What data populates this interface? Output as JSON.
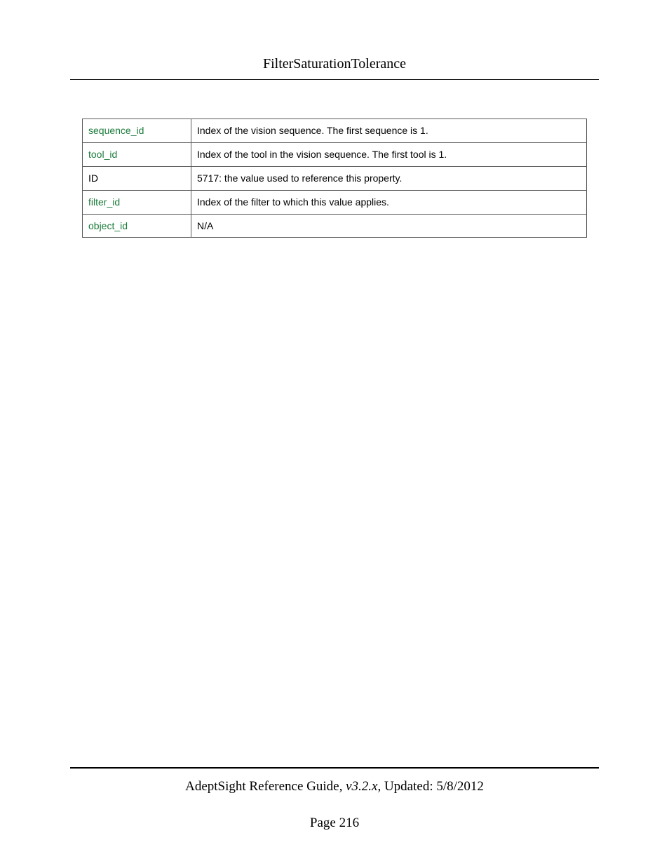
{
  "header": {
    "title": "FilterSaturationTolerance"
  },
  "table": {
    "rows": [
      {
        "key": "sequence_id",
        "keyGreen": true,
        "value": "Index of the vision sequence. The first sequence is 1."
      },
      {
        "key": "tool_id",
        "keyGreen": true,
        "value": "Index of the tool in the vision sequence. The first tool is 1."
      },
      {
        "key": "ID",
        "keyGreen": false,
        "value": "5717: the value used to reference this property."
      },
      {
        "key": "filter_id",
        "keyGreen": true,
        "value": "Index of the filter to which this value applies."
      },
      {
        "key": "object_id",
        "keyGreen": true,
        "value": "N/A"
      }
    ]
  },
  "footer": {
    "guide": "AdeptSight Reference Guide",
    "version": ", v3.2.x",
    "updated": ", Updated: 5/8/2012",
    "page": "Page 216"
  }
}
